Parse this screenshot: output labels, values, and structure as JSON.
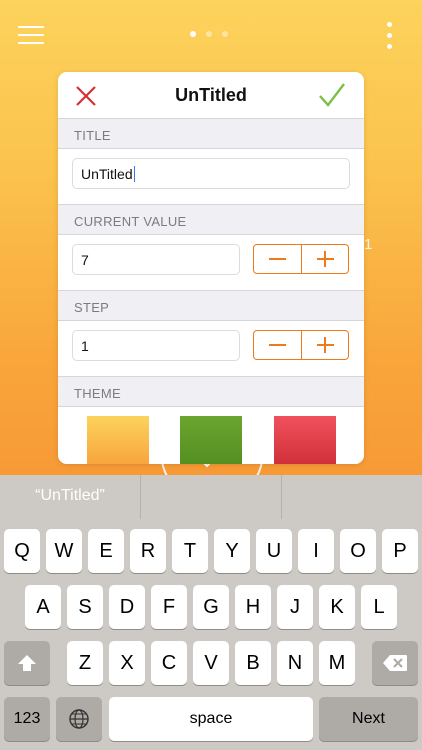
{
  "colors": {
    "accent": "#f07a1a",
    "cancel": "#d7302f",
    "confirm": "#7bc043"
  },
  "background": {
    "digit": "1"
  },
  "header": {
    "menu_icon": "hamburger-menu-icon",
    "more_icon": "vertical-ellipsis-icon",
    "page_count": 3,
    "active_page": 1
  },
  "editor": {
    "title": "UnTitled",
    "cancel_icon": "close-x-icon",
    "confirm_icon": "checkmark-icon",
    "title_section": {
      "label": "TITLE",
      "value": "UnTitled"
    },
    "current_value_section": {
      "label": "CURRENT VALUE",
      "value": "7"
    },
    "step_section": {
      "label": "STEP",
      "value": "1"
    },
    "theme_section": {
      "label": "THEME",
      "swatches": [
        {
          "name": "yellow-orange",
          "colors": [
            "#fcd35c",
            "#f79a36"
          ]
        },
        {
          "name": "green",
          "colors": [
            "#6aa52f",
            "#4f8a1f"
          ]
        },
        {
          "name": "red",
          "colors": [
            "#f0515e",
            "#c8282f"
          ]
        }
      ]
    }
  },
  "suggestions": [
    "“UnTitled”",
    "",
    ""
  ],
  "keyboard": {
    "row1": [
      "Q",
      "W",
      "E",
      "R",
      "T",
      "Y",
      "U",
      "I",
      "O",
      "P"
    ],
    "row2": [
      "A",
      "S",
      "D",
      "F",
      "G",
      "H",
      "J",
      "K",
      "L"
    ],
    "row3": [
      "Z",
      "X",
      "C",
      "V",
      "B",
      "N",
      "M"
    ],
    "numbers_key": "123",
    "space_key": "space",
    "next_key": "Next"
  }
}
